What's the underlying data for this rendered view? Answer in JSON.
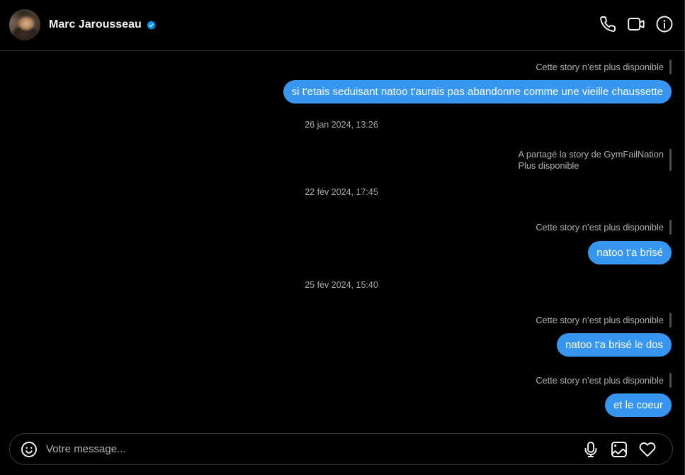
{
  "header": {
    "name": "Marc Jarousseau",
    "avatar_icon": "avatar",
    "badge_icon": "verified-badge-icon",
    "action_icons": [
      "phone-icon",
      "video-camera-icon",
      "info-icon"
    ]
  },
  "thread": [
    {
      "story_label": "Cette story n’est plus disponible"
    },
    {
      "message": "si t'etais seduisant natoo t'aurais pas abandonne comme une vieille chaussette"
    },
    {
      "timestamp": "26 jan 2024, 13:26"
    },
    {
      "shared_story": {
        "line1": "A partagé la story de GymFailNation",
        "line2": "Plus disponible"
      }
    },
    {
      "timestamp": "22 fév 2024, 17:45"
    },
    {
      "story_label": "Cette story n’est plus disponible"
    },
    {
      "message": "natoo t'a brisé"
    },
    {
      "timestamp": "25 fév 2024, 15:40"
    },
    {
      "story_label": "Cette story n’est plus disponible"
    },
    {
      "message": "natoo t'a brisé le dos"
    },
    {
      "story_label": "Cette story n’est plus disponible"
    },
    {
      "message": "et le coeur"
    }
  ],
  "composer": {
    "placeholder": "Votre message...",
    "left_icon": "emoji-icon",
    "right_icons": [
      "microphone-icon",
      "image-icon",
      "heart-icon"
    ]
  },
  "colors": {
    "background": "#000000",
    "bubble": "#3797f0",
    "secondary_text": "#a8a8a8",
    "verified_badge": "#0095f6"
  }
}
